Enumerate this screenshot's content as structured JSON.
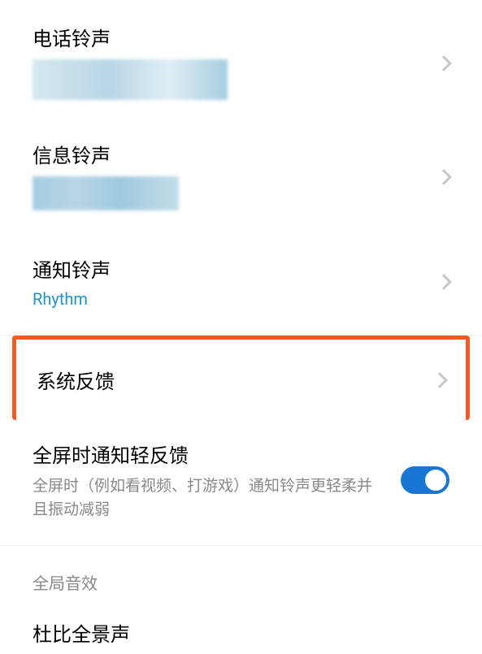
{
  "settings": {
    "phone_ringtone": {
      "title": "电话铃声"
    },
    "message_ringtone": {
      "title": "信息铃声"
    },
    "notification_ringtone": {
      "title": "通知铃声",
      "value": "Rhythm"
    },
    "system_feedback": {
      "title": "系统反馈"
    },
    "fullscreen_feedback": {
      "title": "全屏时通知轻反馈",
      "description": "全屏时（例如看视频、打游戏）通知铃声更轻柔并且振动减弱",
      "enabled": true
    },
    "global_sound": {
      "header": "全局音效"
    },
    "dolby": {
      "title": "杜比全景声"
    }
  }
}
